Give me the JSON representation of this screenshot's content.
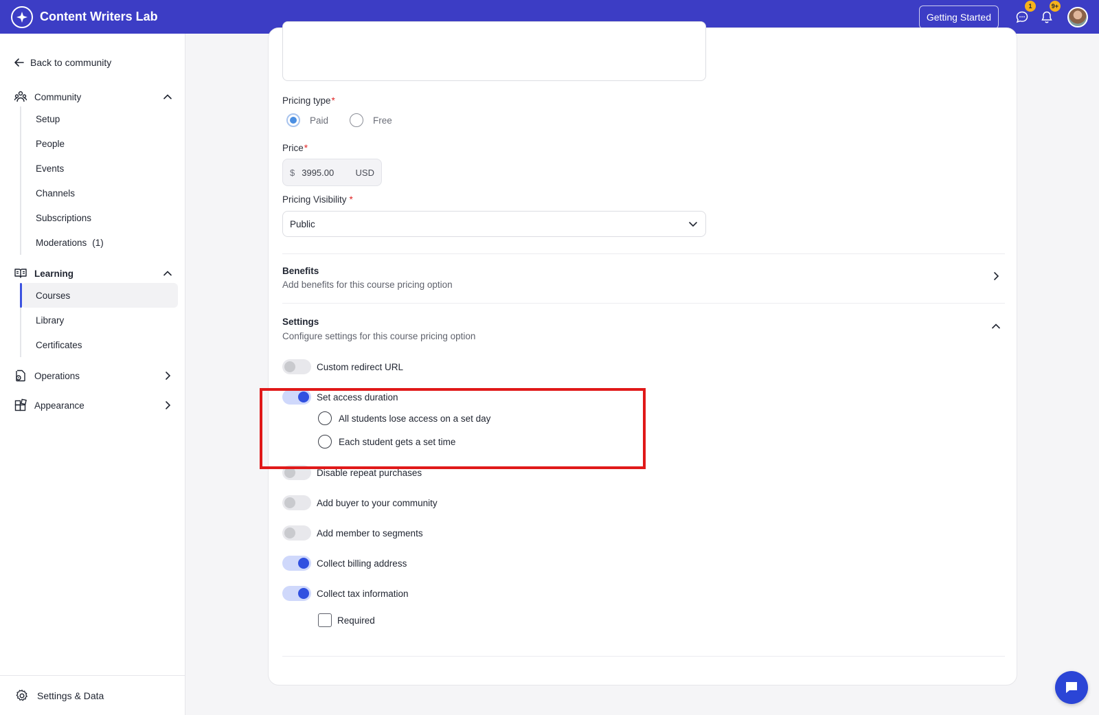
{
  "app": {
    "brand": "Content Writers Lab",
    "getting_started": "Getting Started",
    "messages_badge": "1",
    "notifications_badge": "9+"
  },
  "sidebar": {
    "back": "Back to community",
    "community": {
      "label": "Community",
      "items": [
        "Setup",
        "People",
        "Events",
        "Channels",
        "Subscriptions",
        "Moderations"
      ],
      "moderations_count": "(1)"
    },
    "learning": {
      "label": "Learning",
      "items": [
        "Courses",
        "Library",
        "Certificates"
      ],
      "active": "Courses"
    },
    "operations": "Operations",
    "appearance": "Appearance",
    "settings_data": "Settings & Data"
  },
  "form": {
    "pricing_type_label": "Pricing type",
    "pricing_paid": "Paid",
    "pricing_free": "Free",
    "pricing_selected": "Paid",
    "price_label": "Price",
    "price_currency_symbol": "$",
    "price_value": "3995.00",
    "price_unit": "USD",
    "visibility_label": "Pricing Visibility",
    "visibility_value": "Public",
    "required_mark": "*"
  },
  "benefits": {
    "title": "Benefits",
    "subtitle": "Add benefits for this course pricing option"
  },
  "settings": {
    "title": "Settings",
    "subtitle": "Configure settings for this course pricing option",
    "custom_redirect": {
      "label": "Custom redirect URL",
      "on": false
    },
    "access_duration": {
      "label": "Set access duration",
      "on": true
    },
    "access_option_1": "All students lose access on a set day",
    "access_option_2": "Each student gets a set time",
    "disable_repeat": {
      "label": "Disable repeat purchases",
      "on": false
    },
    "add_buyer": {
      "label": "Add buyer to your community",
      "on": false
    },
    "add_member_segments": {
      "label": "Add member to segments",
      "on": false
    },
    "collect_billing": {
      "label": "Collect billing address",
      "on": true
    },
    "collect_tax": {
      "label": "Collect tax information",
      "on": true
    },
    "tax_required": "Required"
  },
  "colors": {
    "topbar": "#3c3dc5",
    "accent": "#3050e0",
    "highlight": "#e01919"
  }
}
